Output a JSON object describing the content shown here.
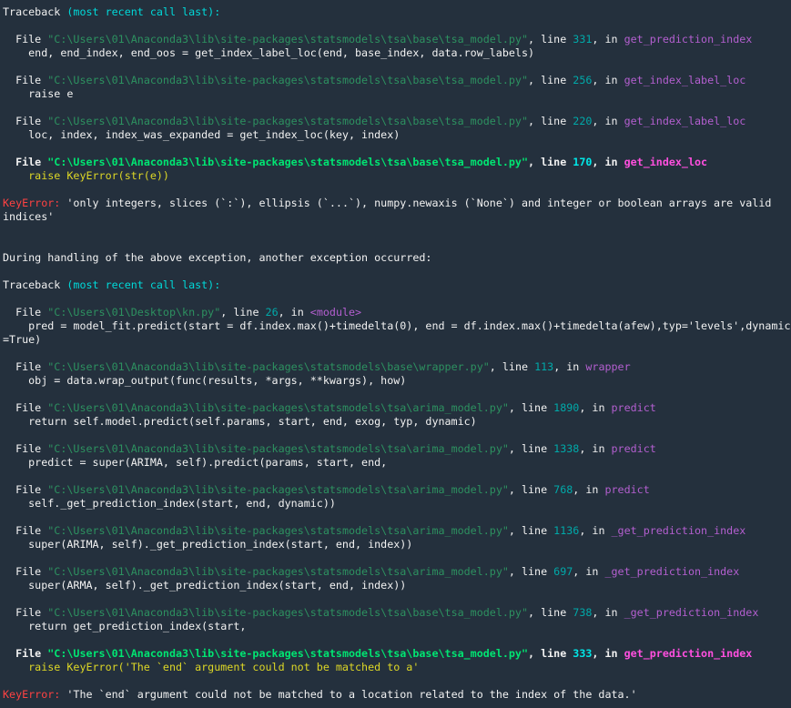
{
  "console": {
    "colors": {
      "background": "#24303d",
      "text": "#f2f2f2",
      "cyan": "#00d9d9",
      "cyan_bright": "#00e8e8",
      "teal": "#00a9a9",
      "green": "#2d9160",
      "green_bright": "#00e572",
      "magenta": "#b45fd0",
      "magenta_bright": "#ff4fdf",
      "yellow": "#ddd726",
      "red": "#ff4242"
    },
    "lines": [
      [
        {
          "t": "Traceback ",
          "s": "plain"
        },
        {
          "t": "(most recent call last):",
          "s": "cyan"
        }
      ],
      [],
      [
        {
          "t": "  File ",
          "s": "plain"
        },
        {
          "t": "\"C:\\Users\\01\\Anaconda3\\lib\\site-packages\\statsmodels\\tsa\\base\\tsa_model.py\"",
          "s": "path"
        },
        {
          "t": ", line ",
          "s": "plain"
        },
        {
          "t": "331",
          "s": "num"
        },
        {
          "t": ", in ",
          "s": "plain"
        },
        {
          "t": "get_prediction_index",
          "s": "func"
        }
      ],
      [
        {
          "t": "    end, end_index, end_oos = get_index_label_loc(end, base_index, data.row_labels)",
          "s": "plain"
        }
      ],
      [],
      [
        {
          "t": "  File ",
          "s": "plain"
        },
        {
          "t": "\"C:\\Users\\01\\Anaconda3\\lib\\site-packages\\statsmodels\\tsa\\base\\tsa_model.py\"",
          "s": "path"
        },
        {
          "t": ", line ",
          "s": "plain"
        },
        {
          "t": "256",
          "s": "num"
        },
        {
          "t": ", in ",
          "s": "plain"
        },
        {
          "t": "get_index_label_loc",
          "s": "func"
        }
      ],
      [
        {
          "t": "    raise e",
          "s": "plain"
        }
      ],
      [],
      [
        {
          "t": "  File ",
          "s": "plain"
        },
        {
          "t": "\"C:\\Users\\01\\Anaconda3\\lib\\site-packages\\statsmodels\\tsa\\base\\tsa_model.py\"",
          "s": "path"
        },
        {
          "t": ", line ",
          "s": "plain"
        },
        {
          "t": "220",
          "s": "num"
        },
        {
          "t": ", in ",
          "s": "plain"
        },
        {
          "t": "get_index_label_loc",
          "s": "func"
        }
      ],
      [
        {
          "t": "    loc, index, index_was_expanded = get_index_loc(key, index)",
          "s": "plain"
        }
      ],
      [],
      [
        {
          "t": "  File ",
          "s": "bold"
        },
        {
          "t": "\"C:\\Users\\01\\Anaconda3\\lib\\site-packages\\statsmodels\\tsa\\base\\tsa_model.py\"",
          "s": "pathB"
        },
        {
          "t": ", line ",
          "s": "bold"
        },
        {
          "t": "170",
          "s": "numB"
        },
        {
          "t": ", in ",
          "s": "bold"
        },
        {
          "t": "get_index_loc",
          "s": "funcB"
        }
      ],
      [
        {
          "t": "    raise KeyError(str(e))",
          "s": "yellow"
        }
      ],
      [],
      [
        {
          "t": "KeyError: ",
          "s": "err"
        },
        {
          "t": "'only integers, slices (`:`), ellipsis (`...`), numpy.newaxis (`None`) and integer or boolean arrays are valid",
          "s": "plain"
        }
      ],
      [
        {
          "t": "indices'",
          "s": "plain"
        }
      ],
      [],
      [],
      [
        {
          "t": "During handling of the above exception, another exception occurred:",
          "s": "plain"
        }
      ],
      [],
      [
        {
          "t": "Traceback ",
          "s": "plain"
        },
        {
          "t": "(most recent call last):",
          "s": "cyan"
        }
      ],
      [],
      [
        {
          "t": "  File ",
          "s": "plain"
        },
        {
          "t": "\"C:\\Users\\01\\Desktop\\kn.py\"",
          "s": "path"
        },
        {
          "t": ", line ",
          "s": "plain"
        },
        {
          "t": "26",
          "s": "num"
        },
        {
          "t": ", in ",
          "s": "plain"
        },
        {
          "t": "<module>",
          "s": "func"
        }
      ],
      [
        {
          "t": "    pred = model_fit.predict(start = df.index.max()+timedelta(0), end = df.index.max()+timedelta(afew),typ='levels',dynamic",
          "s": "plain"
        }
      ],
      [
        {
          "t": "=True)",
          "s": "plain"
        }
      ],
      [],
      [
        {
          "t": "  File ",
          "s": "plain"
        },
        {
          "t": "\"C:\\Users\\01\\Anaconda3\\lib\\site-packages\\statsmodels\\base\\wrapper.py\"",
          "s": "path"
        },
        {
          "t": ", line ",
          "s": "plain"
        },
        {
          "t": "113",
          "s": "num"
        },
        {
          "t": ", in ",
          "s": "plain"
        },
        {
          "t": "wrapper",
          "s": "func"
        }
      ],
      [
        {
          "t": "    obj = data.wrap_output(func(results, *args, **kwargs), how)",
          "s": "plain"
        }
      ],
      [],
      [
        {
          "t": "  File ",
          "s": "plain"
        },
        {
          "t": "\"C:\\Users\\01\\Anaconda3\\lib\\site-packages\\statsmodels\\tsa\\arima_model.py\"",
          "s": "path"
        },
        {
          "t": ", line ",
          "s": "plain"
        },
        {
          "t": "1890",
          "s": "num"
        },
        {
          "t": ", in ",
          "s": "plain"
        },
        {
          "t": "predict",
          "s": "func"
        }
      ],
      [
        {
          "t": "    return self.model.predict(self.params, start, end, exog, typ, dynamic)",
          "s": "plain"
        }
      ],
      [],
      [
        {
          "t": "  File ",
          "s": "plain"
        },
        {
          "t": "\"C:\\Users\\01\\Anaconda3\\lib\\site-packages\\statsmodels\\tsa\\arima_model.py\"",
          "s": "path"
        },
        {
          "t": ", line ",
          "s": "plain"
        },
        {
          "t": "1338",
          "s": "num"
        },
        {
          "t": ", in ",
          "s": "plain"
        },
        {
          "t": "predict",
          "s": "func"
        }
      ],
      [
        {
          "t": "    predict = super(ARIMA, self).predict(params, start, end,",
          "s": "plain"
        }
      ],
      [],
      [
        {
          "t": "  File ",
          "s": "plain"
        },
        {
          "t": "\"C:\\Users\\01\\Anaconda3\\lib\\site-packages\\statsmodels\\tsa\\arima_model.py\"",
          "s": "path"
        },
        {
          "t": ", line ",
          "s": "plain"
        },
        {
          "t": "768",
          "s": "num"
        },
        {
          "t": ", in ",
          "s": "plain"
        },
        {
          "t": "predict",
          "s": "func"
        }
      ],
      [
        {
          "t": "    self._get_prediction_index(start, end, dynamic))",
          "s": "plain"
        }
      ],
      [],
      [
        {
          "t": "  File ",
          "s": "plain"
        },
        {
          "t": "\"C:\\Users\\01\\Anaconda3\\lib\\site-packages\\statsmodels\\tsa\\arima_model.py\"",
          "s": "path"
        },
        {
          "t": ", line ",
          "s": "plain"
        },
        {
          "t": "1136",
          "s": "num"
        },
        {
          "t": ", in ",
          "s": "plain"
        },
        {
          "t": "_get_prediction_index",
          "s": "func"
        }
      ],
      [
        {
          "t": "    super(ARIMA, self)._get_prediction_index(start, end, index))",
          "s": "plain"
        }
      ],
      [],
      [
        {
          "t": "  File ",
          "s": "plain"
        },
        {
          "t": "\"C:\\Users\\01\\Anaconda3\\lib\\site-packages\\statsmodels\\tsa\\arima_model.py\"",
          "s": "path"
        },
        {
          "t": ", line ",
          "s": "plain"
        },
        {
          "t": "697",
          "s": "num"
        },
        {
          "t": ", in ",
          "s": "plain"
        },
        {
          "t": "_get_prediction_index",
          "s": "func"
        }
      ],
      [
        {
          "t": "    super(ARMA, self)._get_prediction_index(start, end, index))",
          "s": "plain"
        }
      ],
      [],
      [
        {
          "t": "  File ",
          "s": "plain"
        },
        {
          "t": "\"C:\\Users\\01\\Anaconda3\\lib\\site-packages\\statsmodels\\tsa\\base\\tsa_model.py\"",
          "s": "path"
        },
        {
          "t": ", line ",
          "s": "plain"
        },
        {
          "t": "738",
          "s": "num"
        },
        {
          "t": ", in ",
          "s": "plain"
        },
        {
          "t": "_get_prediction_index",
          "s": "func"
        }
      ],
      [
        {
          "t": "    return get_prediction_index(start,",
          "s": "plain"
        }
      ],
      [],
      [
        {
          "t": "  File ",
          "s": "bold"
        },
        {
          "t": "\"C:\\Users\\01\\Anaconda3\\lib\\site-packages\\statsmodels\\tsa\\base\\tsa_model.py\"",
          "s": "pathB"
        },
        {
          "t": ", line ",
          "s": "bold"
        },
        {
          "t": "333",
          "s": "numB"
        },
        {
          "t": ", in ",
          "s": "bold"
        },
        {
          "t": "get_prediction_index",
          "s": "funcB"
        }
      ],
      [
        {
          "t": "    raise KeyError('The `end` argument could not be matched to a'",
          "s": "yellow"
        }
      ],
      [],
      [
        {
          "t": "KeyError: ",
          "s": "err"
        },
        {
          "t": "'The `end` argument could not be matched to a location related to the index of the data.'",
          "s": "plain"
        }
      ]
    ]
  }
}
